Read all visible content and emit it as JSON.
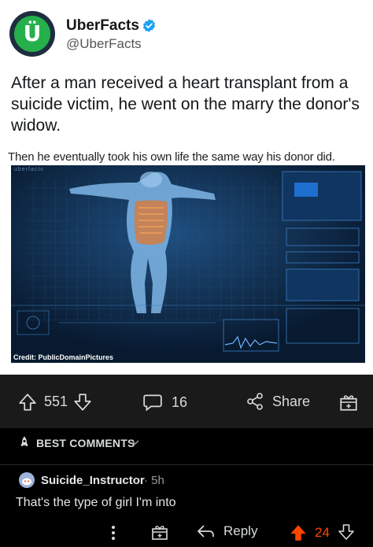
{
  "tweet": {
    "author_name": "UberFacts",
    "handle": "@UberFacts",
    "text": "After a man received a heart transplant from a suicide victim, he went on the marry the donor's widow.",
    "media_caption": "Then he eventually took his own life the same way his donor did.",
    "media_credit": "Credit: PublicDomainPictures",
    "media_watermark": "uberfacts"
  },
  "post_actions": {
    "score": "551",
    "comments": "16",
    "share_label": "Share"
  },
  "comments_header": {
    "sort_label": "BEST COMMENTS"
  },
  "comment": {
    "author": "Suicide_Instructor",
    "time": "· 5h",
    "text": "That's the type of girl I'm into",
    "reply_label": "Reply",
    "score": "24"
  },
  "colors": {
    "upvote": "#ff4500",
    "brand_green": "#26b04b",
    "verified_blue": "#1da1f2"
  }
}
